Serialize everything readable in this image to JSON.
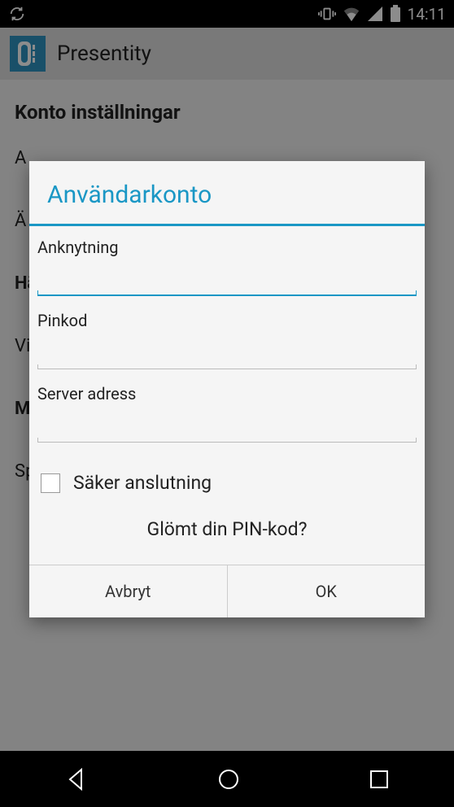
{
  "status": {
    "time": "14:11"
  },
  "app": {
    "title": "Presentity"
  },
  "page": {
    "heading": "Konto inställningar",
    "items": [
      "A",
      "Ä",
      "Hä",
      "Vi",
      "M",
      "Sp"
    ]
  },
  "dialog": {
    "title": "Användarkonto",
    "fields": {
      "extension": {
        "label": "Anknytning",
        "value": ""
      },
      "pin": {
        "label": "Pinkod",
        "value": ""
      },
      "server": {
        "label": "Server adress",
        "value": ""
      }
    },
    "secure": {
      "label": "Säker anslutning",
      "checked": false
    },
    "forgot": "Glömt din PIN-kod?",
    "buttons": {
      "cancel": "Avbryt",
      "ok": "OK"
    }
  }
}
